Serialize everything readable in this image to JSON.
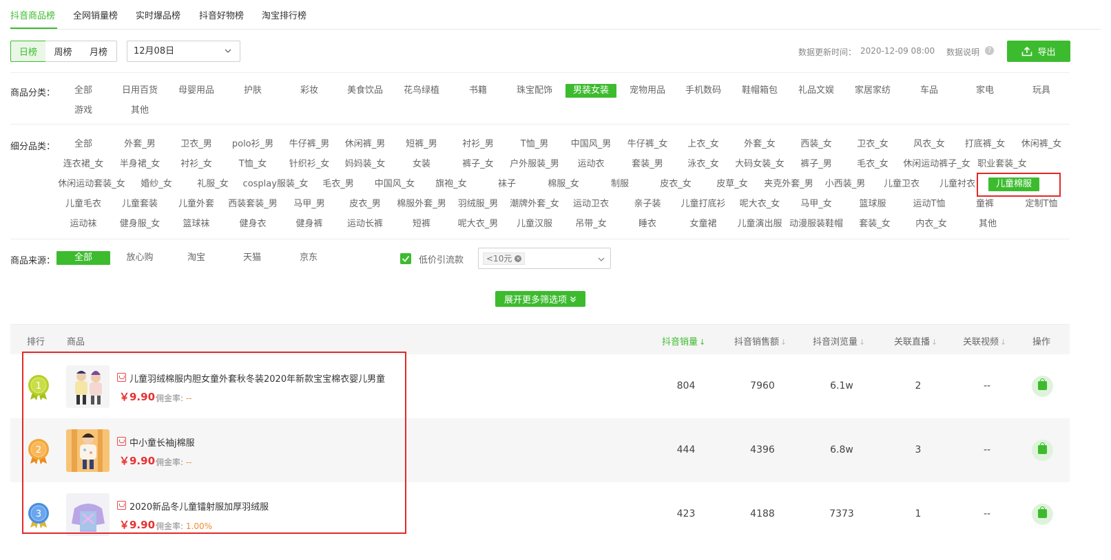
{
  "tabs": [
    "抖音商品榜",
    "全网销量榜",
    "实时爆品榜",
    "抖音好物榜",
    "淘宝排行榜"
  ],
  "period": [
    "日榜",
    "周榜",
    "月榜"
  ],
  "date": "12月08日",
  "update": {
    "label": "数据更新时间：",
    "value": "2020-12-09 08:00",
    "explain": "数据说明",
    "help": "?"
  },
  "export_label": "导出",
  "filters": {
    "category_label": "商品分类：",
    "categories": [
      "全部",
      "日用百货",
      "母婴用品",
      "护肤",
      "彩妆",
      "美食饮品",
      "花鸟绿植",
      "书籍",
      "珠宝配饰",
      "男装女装",
      "宠物用品",
      "手机数码",
      "鞋帽箱包",
      "礼品文娱",
      "家居家纺",
      "车品",
      "家电",
      "玩具",
      "游戏",
      "其他"
    ],
    "sub_label": "细分品类：",
    "sub_rows": [
      [
        "全部",
        "外套_男",
        "卫衣_男",
        "polo衫_男",
        "牛仔裤_男",
        "休闲裤_男",
        "短裤_男",
        "衬衫_男",
        "T恤_男",
        "中国风_男",
        "牛仔裤_女",
        "上衣_女",
        "外套_女",
        "西装_女",
        "卫衣_女",
        "风衣_女",
        "打底裤_女",
        "休闲裤_女"
      ],
      [
        "连衣裙_女",
        "半身裙_女",
        "衬衫_女",
        "T恤_女",
        "针织衫_女",
        "妈妈装_女",
        "女装",
        "裤子_女",
        "户外服装_男",
        "运动衣",
        "套装_男",
        "泳衣_女",
        "大码女装_女",
        "裤子_男",
        "毛衣_女",
        "休闲运动裤子_女",
        "职业套装_女"
      ],
      [
        "休闲运动套装_女",
        "婚纱_女",
        "礼服_女",
        "cosplay服装_女",
        "毛衣_男",
        "中国风_女",
        "旗袍_女",
        "袜子",
        "棉服_女",
        "制服",
        "皮衣_女",
        "皮草_女",
        "夹克外套_男",
        "小西装_男",
        "儿童卫衣",
        "儿童衬衣",
        "儿童棉服"
      ],
      [
        "儿童毛衣",
        "儿童套装",
        "儿童外套",
        "西装套装_男",
        "马甲_男",
        "皮衣_男",
        "棉服外套_男",
        "羽绒服_男",
        "潮牌外套_女",
        "运动卫衣",
        "亲子装",
        "儿童打底衫",
        "呢大衣_女",
        "马甲_女",
        "篮球服",
        "运动T恤",
        "童裤",
        "定制T恤"
      ],
      [
        "运动袜",
        "健身服_女",
        "篮球袜",
        "健身衣",
        "健身裤",
        "运动长裤",
        "短裤",
        "呢大衣_男",
        "儿童汉服",
        "吊带_女",
        "睡衣",
        "女童裙",
        "儿童演出服",
        "动漫服装鞋帽",
        "套装_女",
        "内衣_女",
        "其他"
      ]
    ],
    "source_label": "商品来源：",
    "sources": [
      "全部",
      "放心购",
      "淘宝",
      "天猫",
      "京东"
    ],
    "lowprice_label": "低价引流款",
    "price_tag": "<10元",
    "more_label": "展开更多筛选项"
  },
  "table": {
    "headers": {
      "rank": "排行",
      "product": "商品",
      "sales": "抖音销量",
      "amount": "抖音销售额",
      "views": "抖音浏览量",
      "live": "关联直播",
      "video": "关联视频",
      "action": "操作"
    },
    "commission_label": "佣金率:",
    "rows": [
      {
        "rank": "1",
        "title": "儿童羽绒棉服内胆女童外套秋冬装2020年新款宝宝棉衣婴儿男童",
        "price": "￥9.90",
        "commission": "--",
        "sales": "804",
        "amount": "7960",
        "views": "6.1w",
        "live": "2",
        "video": "--"
      },
      {
        "rank": "2",
        "title": "中小童长袖j棉服",
        "price": "￥9.90",
        "commission": "--",
        "sales": "444",
        "amount": "4396",
        "views": "6.8w",
        "live": "3",
        "video": "--"
      },
      {
        "rank": "3",
        "title": "2020新品冬儿童镭射服加厚羽绒服",
        "price": "￥9.90",
        "commission": "1.00%",
        "sales": "423",
        "amount": "4188",
        "views": "7373",
        "live": "1",
        "video": "--"
      }
    ]
  },
  "colors": {
    "accent": "#3dbb2f",
    "highlight_box": "#e22828",
    "price": "#e83030",
    "gold": "#b8cf2a",
    "orange": "#f5a53a",
    "blue": "#4a8fe0"
  }
}
